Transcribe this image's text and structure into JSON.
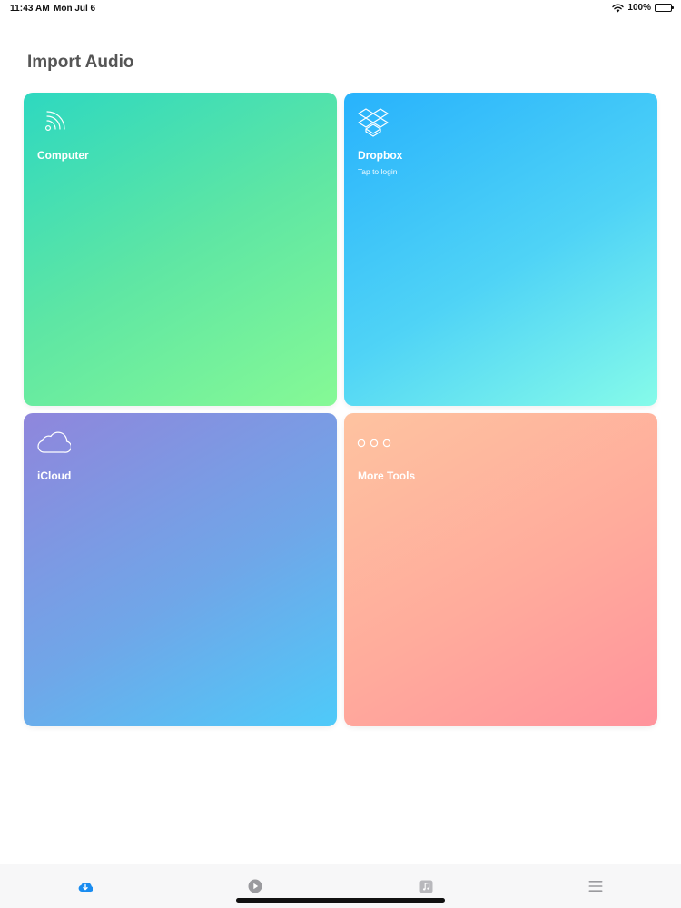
{
  "status_bar": {
    "time": "11:43 AM",
    "date": "Mon Jul 6",
    "battery": "100%",
    "battery_level": 1.0
  },
  "page": {
    "title": "Import Audio"
  },
  "tiles": [
    {
      "label": "Computer",
      "icon": "wifi-sharing-icon",
      "subtitle": ""
    },
    {
      "label": "Dropbox",
      "icon": "dropbox-icon",
      "subtitle": "Tap to login"
    },
    {
      "label": "iCloud",
      "icon": "cloud-icon",
      "subtitle": ""
    },
    {
      "label": "More Tools",
      "icon": "more-dots-icon",
      "subtitle": ""
    }
  ],
  "tab_bar": {
    "items": [
      {
        "icon": "download-cloud-icon",
        "active": true
      },
      {
        "icon": "play-icon",
        "active": false
      },
      {
        "icon": "music-note-icon",
        "active": false
      },
      {
        "icon": "menu-icon",
        "active": false
      }
    ],
    "active_color": "#1a8cf0",
    "inactive_color": "#9a9a9e"
  },
  "colors": {
    "title": "#555555",
    "computer_gradient": [
      "#2ed8c0",
      "#86f995"
    ],
    "dropbox_gradient": [
      "#28b2fc",
      "#86fbe9"
    ],
    "icloud_gradient": [
      "#8f86dc",
      "#4ecaf9"
    ],
    "more_gradient": [
      "#fec3a0",
      "#ff939c"
    ]
  }
}
